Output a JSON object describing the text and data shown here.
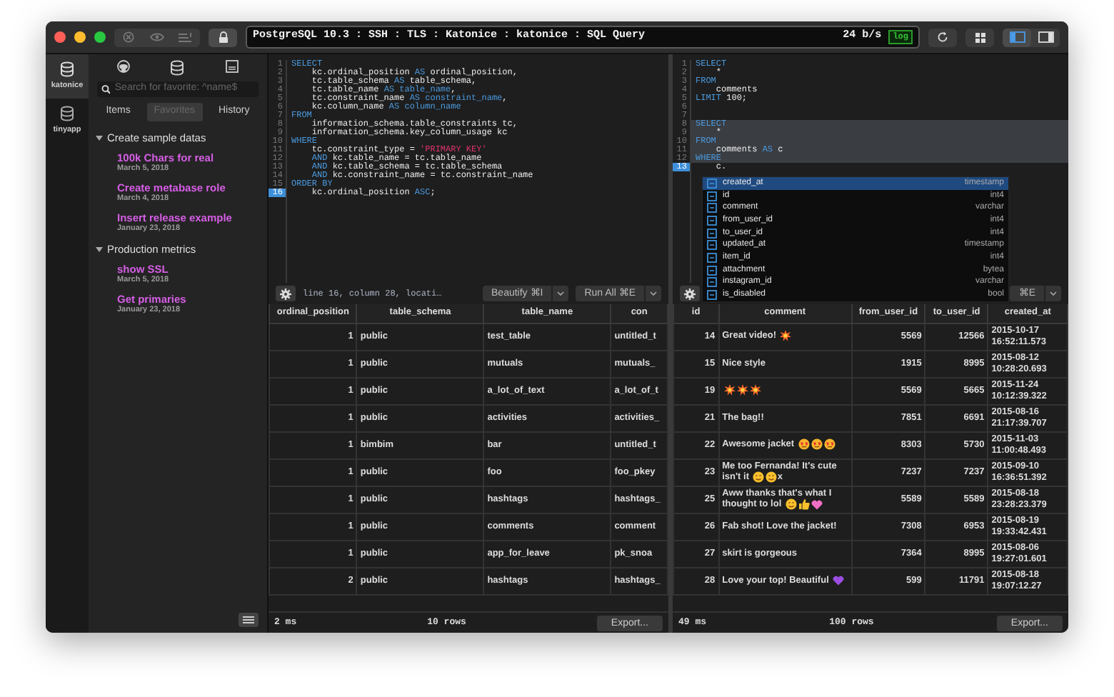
{
  "window": {
    "title": "PostgreSQL 10.3 : SSH : TLS : Katonice : katonice : SQL Query",
    "rate": "24 b/s",
    "log_badge": "log"
  },
  "layout_toggles": [
    {
      "selected": true
    },
    {
      "selected": false
    }
  ],
  "connections": [
    {
      "label": "katonice",
      "selected": true
    },
    {
      "label": "tinyapp",
      "selected": false
    }
  ],
  "sidebar": {
    "search": {
      "placeholder": "Search for favorite: ^name$"
    },
    "tabs": [
      {
        "label": "Items",
        "selected": false
      },
      {
        "label": "Favorites",
        "selected": true
      },
      {
        "label": "History",
        "selected": false
      }
    ],
    "groups": [
      {
        "title": "Create sample datas",
        "expanded": true,
        "children": [
          {
            "name": "100k Chars for real",
            "date": "March 5, 2018"
          },
          {
            "name": "Create metabase role",
            "date": "March 4, 2018"
          },
          {
            "name": "Insert release example",
            "date": "January 23, 2018"
          }
        ]
      },
      {
        "title": "Production metrics",
        "expanded": true,
        "children": [
          {
            "name": "show SSL",
            "date": "March 5, 2018"
          },
          {
            "name": "Get primaries",
            "date": "January 23, 2018"
          }
        ]
      }
    ]
  },
  "panes": [
    {
      "editor": {
        "lines": [
          {
            "number": "1",
            "current": false,
            "highlighted": false,
            "segments": [
              {
                "kind": "keyword",
                "text": "SELECT"
              }
            ]
          },
          {
            "number": "2",
            "current": false,
            "highlighted": false,
            "segments": [
              {
                "kind": "plain",
                "text": "    kc.ordinal_position "
              },
              {
                "kind": "keyword",
                "text": "AS"
              },
              {
                "kind": "plain",
                "text": " ordinal_position,"
              }
            ]
          },
          {
            "number": "3",
            "current": false,
            "highlighted": false,
            "segments": [
              {
                "kind": "plain",
                "text": "    tc.table_schema "
              },
              {
                "kind": "keyword",
                "text": "AS"
              },
              {
                "kind": "plain",
                "text": " table_schema,"
              }
            ]
          },
          {
            "number": "4",
            "current": false,
            "highlighted": false,
            "segments": [
              {
                "kind": "plain",
                "text": "    tc.table_name "
              },
              {
                "kind": "keyword",
                "text": "AS table_name"
              },
              {
                "kind": "plain",
                "text": ","
              }
            ]
          },
          {
            "number": "5",
            "current": false,
            "highlighted": false,
            "segments": [
              {
                "kind": "plain",
                "text": "    tc.constraint_name "
              },
              {
                "kind": "keyword",
                "text": "AS constraint_name"
              },
              {
                "kind": "plain",
                "text": ","
              }
            ]
          },
          {
            "number": "6",
            "current": false,
            "highlighted": false,
            "segments": [
              {
                "kind": "plain",
                "text": "    kc.column_name "
              },
              {
                "kind": "keyword",
                "text": "AS column_name"
              }
            ]
          },
          {
            "number": "7",
            "current": false,
            "highlighted": false,
            "segments": [
              {
                "kind": "keyword",
                "text": "FROM"
              }
            ]
          },
          {
            "number": "8",
            "current": false,
            "highlighted": false,
            "segments": [
              {
                "kind": "plain",
                "text": "    information_schema.table_constraints tc,"
              }
            ]
          },
          {
            "number": "9",
            "current": false,
            "highlighted": false,
            "segments": [
              {
                "kind": "plain",
                "text": "    information_schema.key_column_usage kc"
              }
            ]
          },
          {
            "number": "10",
            "current": false,
            "highlighted": false,
            "segments": [
              {
                "kind": "keyword",
                "text": "WHERE"
              }
            ]
          },
          {
            "number": "11",
            "current": false,
            "highlighted": false,
            "segments": [
              {
                "kind": "plain",
                "text": "    tc.constraint_type = "
              },
              {
                "kind": "string",
                "text": "'PRIMARY KEY'"
              }
            ]
          },
          {
            "number": "12",
            "current": false,
            "highlighted": false,
            "segments": [
              {
                "kind": "keyword",
                "text": "    AND"
              },
              {
                "kind": "plain",
                "text": " kc.table_name = tc.table_name"
              }
            ]
          },
          {
            "number": "13",
            "current": false,
            "highlighted": false,
            "segments": [
              {
                "kind": "keyword",
                "text": "    AND"
              },
              {
                "kind": "plain",
                "text": " kc.table_schema = tc.table_schema"
              }
            ]
          },
          {
            "number": "14",
            "current": false,
            "highlighted": false,
            "segments": [
              {
                "kind": "keyword",
                "text": "    AND"
              },
              {
                "kind": "plain",
                "text": " kc.constraint_name = tc.constraint_name"
              }
            ]
          },
          {
            "number": "15",
            "current": false,
            "highlighted": false,
            "segments": [
              {
                "kind": "keyword",
                "text": "ORDER BY"
              }
            ]
          },
          {
            "number": "16",
            "current": true,
            "highlighted": false,
            "segments": [
              {
                "kind": "plain",
                "text": "    kc.ordinal_position "
              },
              {
                "kind": "keyword",
                "text": "ASC"
              },
              {
                "kind": "plain",
                "text": ";"
              }
            ]
          }
        ]
      },
      "status_text": "line 16, column 28, locati…",
      "buttons": [
        {
          "label": "Beautify ⌘I"
        },
        {
          "label": "Run All ⌘E"
        }
      ],
      "table": {
        "columns": [
          {
            "label": "ordinal_position",
            "kind": "number"
          },
          {
            "label": "table_schema",
            "kind": "text"
          },
          {
            "label": "table_name",
            "kind": "text"
          },
          {
            "label": "con",
            "kind": "text"
          }
        ],
        "rows": [
          [
            "1",
            "public",
            "test_table",
            "untitled_t"
          ],
          [
            "1",
            "public",
            "mutuals",
            "mutuals_"
          ],
          [
            "1",
            "public",
            "a_lot_of_text",
            "a_lot_of_t"
          ],
          [
            "1",
            "public",
            "activities",
            "activities_"
          ],
          [
            "1",
            "bimbim",
            "bar",
            "untitled_t"
          ],
          [
            "1",
            "public",
            "foo",
            "foo_pkey"
          ],
          [
            "1",
            "public",
            "hashtags",
            "hashtags_"
          ],
          [
            "1",
            "public",
            "comments",
            "comment"
          ],
          [
            "1",
            "public",
            "app_for_leave",
            "pk_snoa"
          ],
          [
            "2",
            "public",
            "hashtags",
            "hashtags_"
          ]
        ]
      },
      "status_bar": {
        "time": "2 ms",
        "rows": "10 rows",
        "export": "Export..."
      }
    },
    {
      "editor": {
        "lines": [
          {
            "number": "1",
            "current": false,
            "highlighted": false,
            "segments": [
              {
                "kind": "keyword",
                "text": "SELECT"
              }
            ]
          },
          {
            "number": "2",
            "current": false,
            "highlighted": false,
            "segments": [
              {
                "kind": "plain",
                "text": "    *"
              }
            ]
          },
          {
            "number": "3",
            "current": false,
            "highlighted": false,
            "segments": [
              {
                "kind": "keyword",
                "text": "FROM"
              }
            ]
          },
          {
            "number": "4",
            "current": false,
            "highlighted": false,
            "segments": [
              {
                "kind": "plain",
                "text": "    comments"
              }
            ]
          },
          {
            "number": "5",
            "current": false,
            "highlighted": false,
            "segments": [
              {
                "kind": "keyword",
                "text": "LIMIT"
              },
              {
                "kind": "plain",
                "text": " 100;"
              }
            ]
          },
          {
            "number": "6",
            "current": false,
            "highlighted": false
          },
          {
            "number": "7",
            "current": false,
            "highlighted": false
          },
          {
            "number": "8",
            "current": false,
            "highlighted": true,
            "segments": [
              {
                "kind": "keyword",
                "text": "SELECT"
              }
            ]
          },
          {
            "number": "9",
            "current": false,
            "highlighted": true,
            "segments": [
              {
                "kind": "plain",
                "text": "    *"
              }
            ]
          },
          {
            "number": "10",
            "current": false,
            "highlighted": true,
            "segments": [
              {
                "kind": "keyword",
                "text": "FROM"
              }
            ]
          },
          {
            "number": "11",
            "current": false,
            "highlighted": true,
            "segments": [
              {
                "kind": "plain",
                "text": "    comments "
              },
              {
                "kind": "keyword",
                "text": "AS"
              },
              {
                "kind": "plain",
                "text": " c"
              }
            ]
          },
          {
            "number": "12",
            "current": false,
            "highlighted": true,
            "segments": [
              {
                "kind": "keyword",
                "text": "WHERE"
              }
            ]
          },
          {
            "number": "13",
            "current": true,
            "highlighted": false,
            "segments": [
              {
                "kind": "plain",
                "text": "    c."
              }
            ]
          }
        ]
      },
      "autocomplete": {
        "items": [
          {
            "name": "created_at",
            "type": "timestamp",
            "selected": true
          },
          {
            "name": "id",
            "type": "int4",
            "selected": false
          },
          {
            "name": "comment",
            "type": "varchar",
            "selected": false
          },
          {
            "name": "from_user_id",
            "type": "int4",
            "selected": false
          },
          {
            "name": "to_user_id",
            "type": "int4",
            "selected": false
          },
          {
            "name": "updated_at",
            "type": "timestamp",
            "selected": false
          },
          {
            "name": "item_id",
            "type": "int4",
            "selected": false
          },
          {
            "name": "attachment",
            "type": "bytea",
            "selected": false
          },
          {
            "name": "instagram_id",
            "type": "varchar",
            "selected": false
          },
          {
            "name": "is_disabled",
            "type": "bool",
            "selected": false
          }
        ]
      },
      "buttons": [
        {
          "label": "⌘E"
        }
      ],
      "table": {
        "columns": [
          {
            "label": "id",
            "kind": "number"
          },
          {
            "label": "comment",
            "kind": "text"
          },
          {
            "label": "from_user_id",
            "kind": "number"
          },
          {
            "label": "to_user_id",
            "kind": "number"
          },
          {
            "label": "created_at",
            "kind": "text"
          }
        ],
        "rows": [
          [
            "14",
            [
              {
                "kind": "text",
                "text": "Great video!"
              },
              {
                "kind": "burst"
              }
            ],
            "5569",
            "12566",
            "2015-10-17 16:52:11.573"
          ],
          [
            "15",
            [
              {
                "kind": "text",
                "text": "Nice style"
              }
            ],
            "1915",
            "8995",
            "2015-08-12 10:28:20.693"
          ],
          [
            "19",
            [
              {
                "kind": "burst"
              },
              {
                "kind": "burst"
              },
              {
                "kind": "burst"
              }
            ],
            "5569",
            "5665",
            "2015-11-24 10:12:39.322"
          ],
          [
            "21",
            [
              {
                "kind": "text",
                "text": "The bag!!"
              }
            ],
            "7851",
            "6691",
            "2015-08-16 21:17:39.707"
          ],
          [
            "22",
            [
              {
                "kind": "text",
                "text": "Awesome jacket"
              },
              {
                "kind": "heart-eyes"
              },
              {
                "kind": "heart-eyes"
              },
              {
                "kind": "heart-eyes"
              }
            ],
            "8303",
            "5730",
            "2015-11-03 11:00:48.493"
          ],
          [
            "23",
            [
              {
                "kind": "text",
                "text": "Me too Fernanda! It's cute isn't it"
              },
              {
                "kind": "smile"
              },
              {
                "kind": "smile"
              },
              {
                "kind": "text",
                "text": "x"
              }
            ],
            "7237",
            "7237",
            "2015-09-10 16:36:51.392"
          ],
          [
            "25",
            [
              {
                "kind": "text",
                "text": "Aww thanks that's what I thought to lol"
              },
              {
                "kind": "smile"
              },
              {
                "kind": "thumbs-up"
              },
              {
                "kind": "heart",
                "color": "#f06ec4"
              }
            ],
            "5589",
            "5589",
            "2015-08-18 23:28:23.379"
          ],
          [
            "26",
            [
              {
                "kind": "text",
                "text": "Fab shot! Love the jacket!"
              }
            ],
            "7308",
            "6953",
            "2015-08-19 19:33:42.431"
          ],
          [
            "27",
            [
              {
                "kind": "text",
                "text": "skirt is gorgeous"
              }
            ],
            "7364",
            "8995",
            "2015-08-06 19:27:01.601"
          ],
          [
            "28",
            [
              {
                "kind": "text",
                "text": "Love your top! Beautiful"
              },
              {
                "kind": "heart",
                "color": "#9b4de0"
              }
            ],
            "599",
            "11791",
            "2015-08-18 19:07:12.27"
          ]
        ]
      },
      "status_bar": {
        "time": "49 ms",
        "rows": "100 rows",
        "export": "Export..."
      }
    }
  ]
}
